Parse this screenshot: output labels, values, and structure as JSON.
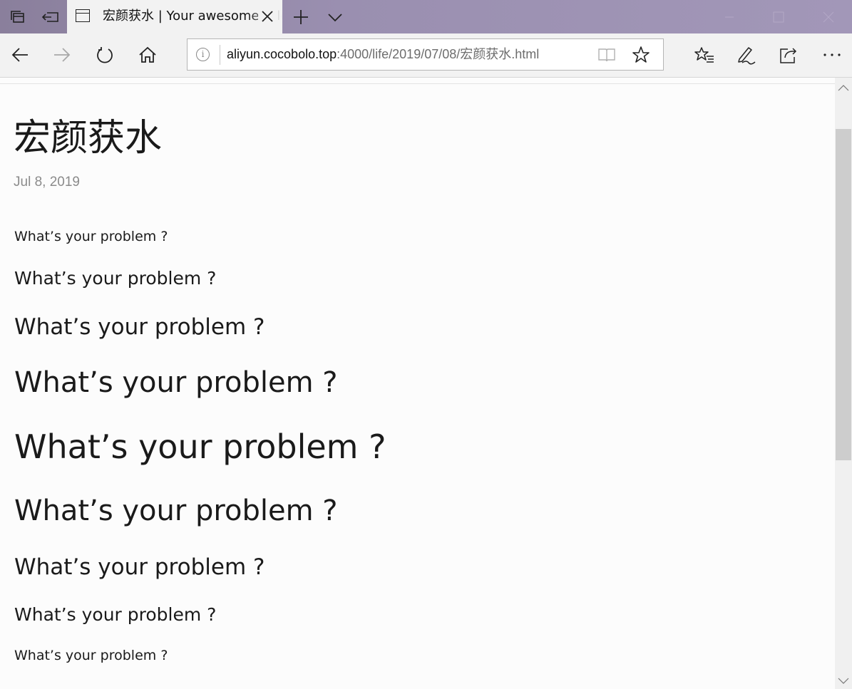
{
  "browser": {
    "tab_title": "宏颜获水 | Your awesome title",
    "url_host": "aliyun.cocobolo.top",
    "url_path": ":4000/life/2019/07/08/宏颜获水.html",
    "icons": {
      "tab_manager": "set-aside-tabs-icon",
      "tab_back": "tabs-aside-icon",
      "page": "page-icon",
      "close": "close-icon",
      "new_tab": "plus-icon",
      "tab_list": "chevron-down-icon",
      "back": "arrow-left-icon",
      "forward": "arrow-right-icon",
      "refresh": "refresh-icon",
      "home": "home-icon",
      "info": "info-icon",
      "reading_view": "book-icon",
      "favorite": "star-icon",
      "favorites_hub": "favorites-list-icon",
      "notes": "pen-icon",
      "share": "share-icon",
      "more": "more-icon"
    },
    "colors": {
      "titlebar": "#9a8fb0",
      "toolbar": "#f2f2f2",
      "page_bg": "#fcfcfc",
      "date_text": "#8b8b8b"
    }
  },
  "page": {
    "title": "宏颜获水",
    "date": "Jul 8, 2019",
    "lines": [
      "What’s your problem ?",
      "What’s your problem ?",
      "What’s your problem ?",
      "What’s your problem ?",
      "What’s your problem ?",
      "What’s your problem ?",
      "What’s your problem ?",
      "What’s your problem ?",
      "What’s your problem ?"
    ]
  }
}
